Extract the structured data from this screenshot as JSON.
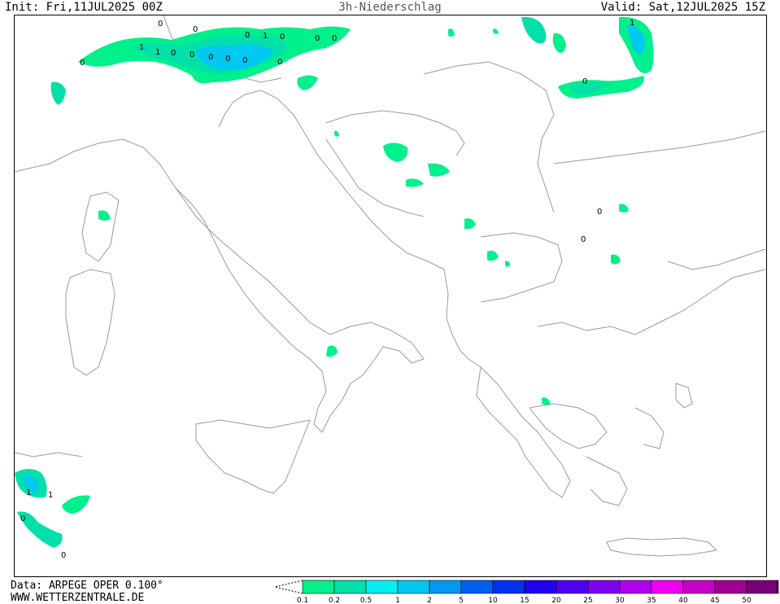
{
  "header": {
    "init": "Init: Fri,11JUL2025 00Z",
    "title": "3h-Niederschlag",
    "valid": "Valid: Sat,12JUL2025 15Z"
  },
  "footer": {
    "data_source": "Data: ARPEGE OPER 0.100°",
    "website": "WWW.WETTERZENTRALE.DE"
  },
  "legend": {
    "levels": [
      "0.1",
      "0.2",
      "0.5",
      "1",
      "2",
      "5",
      "10",
      "15",
      "20",
      "25",
      "30",
      "35",
      "40",
      "45",
      "50"
    ],
    "colors": [
      "#00f08c",
      "#00e0a8",
      "#00f0f0",
      "#00c8f0",
      "#0098f0",
      "#0060f0",
      "#0030f0",
      "#2000f0",
      "#5000f0",
      "#8000f0",
      "#b000f0",
      "#f000f0",
      "#c800c8",
      "#a00090",
      "#780078"
    ]
  },
  "map": {
    "point_labels": [
      "0",
      "1",
      "0",
      "0",
      "1",
      "0",
      "0",
      "0",
      "0",
      "0",
      "0",
      "1",
      "0",
      "1",
      "0",
      "0",
      "0",
      "0",
      "0",
      "1",
      "1",
      "0",
      "0",
      "0"
    ]
  }
}
